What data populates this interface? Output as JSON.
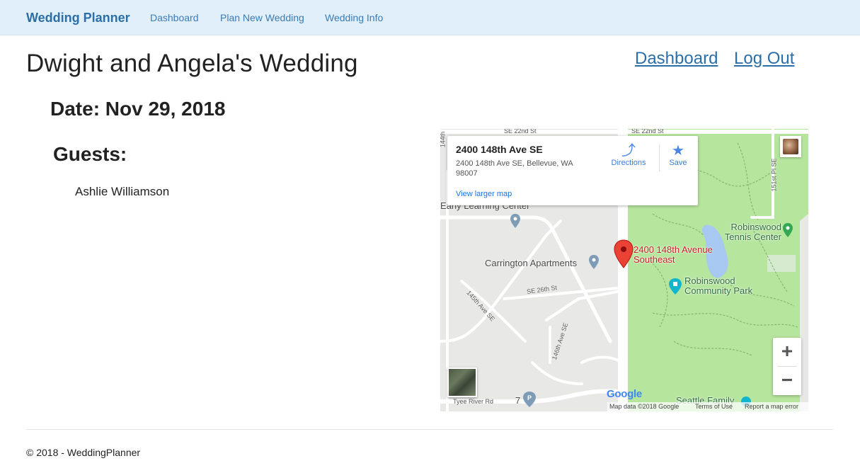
{
  "nav": {
    "brand": "Wedding Planner",
    "links": [
      "Dashboard",
      "Plan New Wedding",
      "Wedding Info"
    ]
  },
  "page": {
    "title": "Dwight and Angela's Wedding",
    "top_links": [
      "Dashboard",
      "Log Out"
    ],
    "date_line": "Date: Nov 29, 2018",
    "guests_heading": "Guests:",
    "guests": [
      "Ashlie Williamson"
    ]
  },
  "map": {
    "card": {
      "title": "2400 148th Ave SE",
      "address": "2400 148th Ave SE, Bellevue, WA 98007",
      "view_larger": "View larger map",
      "directions": "Directions",
      "save": "Save"
    },
    "marker_label": "2400 148th Avenue Southeast",
    "places": {
      "early_learning": "Early Learning Center",
      "carrington": "Carrington Apartments",
      "tennis": "Robinswood Tennis Center",
      "park": "Robinswood Community Park",
      "seattle_family": "Seattle Family",
      "parking_number": "7"
    },
    "streets": {
      "se22_left": "SE 22nd St",
      "se22_right": "SE 22nd St",
      "se26": "SE 26th St",
      "ave145": "145th Ave SE",
      "ave146": "146th Ave SE",
      "pl151": "151st Pl SE",
      "tyee": "Tyee River Rd",
      "ave144": "144th"
    },
    "google": "Google",
    "attribution": {
      "map_data": "Map data ©2018 Google",
      "terms": "Terms of Use",
      "report": "Report a map error"
    },
    "colors": {
      "park": "#b6e59e",
      "marker": "#ea4335",
      "road": "#ffffff"
    }
  },
  "footer": {
    "text": "© 2018 - WeddingPlanner"
  }
}
